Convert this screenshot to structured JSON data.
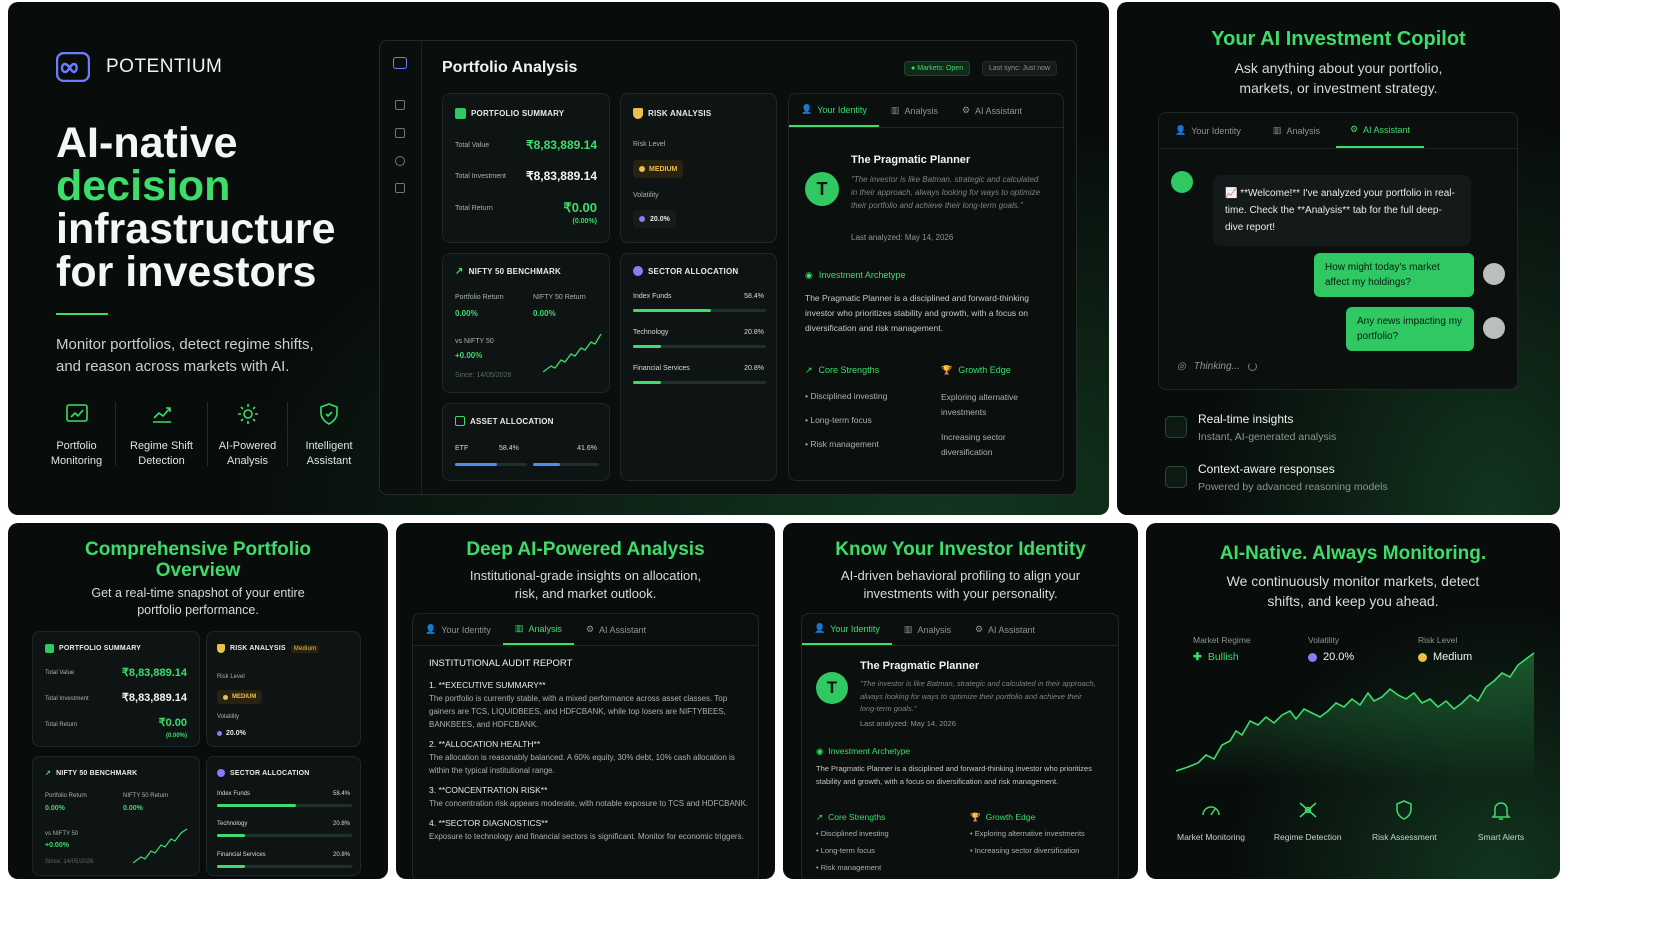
{
  "hero": {
    "brand": "POTENTIUM",
    "title_l1": "AI-native",
    "title_l2": "decision",
    "title_l3": "infrastructure",
    "title_l4": "for investors",
    "tagline_l1": "Monitor portfolios, detect regime shifts,",
    "tagline_l2": "and reason across markets with AI.",
    "features": [
      {
        "l1": "Portfolio",
        "l2": "Monitoring",
        "icon": "monitor-chart-icon"
      },
      {
        "l1": "Regime Shift",
        "l2": "Detection",
        "icon": "trend-chart-icon"
      },
      {
        "l1": "AI-Powered",
        "l2": "Analysis",
        "icon": "gear-icon"
      },
      {
        "l1": "Intelligent",
        "l2": "Assistant",
        "icon": "shield-icon"
      }
    ]
  },
  "dash": {
    "title": "Portfolio Analysis",
    "markets": "Markets: Open",
    "sync": "Last sync: Just now",
    "summary": {
      "title": "PORTFOLIO SUMMARY",
      "total_value_label": "Total Value",
      "total_value": "₹8,83,889.14",
      "total_inv_label": "Total Investment",
      "total_inv": "₹8,83,889.14",
      "total_ret_label": "Total Return",
      "total_ret": "₹0.00",
      "total_ret_pct": "(0.00%)"
    },
    "risk": {
      "title": "RISK ANALYSIS",
      "level_label": "Risk Level",
      "level": "MEDIUM",
      "vol_label": "Volatility",
      "vol": "20.0%"
    },
    "nifty": {
      "title": "NIFTY 50 BENCHMARK",
      "port_ret_label": "Portfolio Return",
      "port_ret": "0.00%",
      "nifty_ret_label": "NIFTY 50 Return",
      "nifty_ret": "0.00%",
      "vs_label": "vs NIFTY 50",
      "vs": "+0.00%",
      "since": "Since: 14/05/2026"
    },
    "sector": {
      "title": "SECTOR ALLOCATION",
      "items": [
        {
          "name": "Index Funds",
          "pct": "58.4%",
          "frac": 0.584
        },
        {
          "name": "Technology",
          "pct": "20.8%",
          "frac": 0.208
        },
        {
          "name": "Financial Services",
          "pct": "20.8%",
          "frac": 0.208
        }
      ]
    },
    "asset": {
      "title": "ASSET ALLOCATION",
      "etf": "ETF",
      "etf_pct": "58.4%",
      "other_pct": "41.6%",
      "etf_frac": 0.584,
      "other_frac": 0.416
    },
    "identity": {
      "tabs": [
        "Your Identity",
        "Analysis",
        "AI Assistant"
      ],
      "initial": "T",
      "name": "The Pragmatic Planner",
      "quote": "\"The investor is like Batman, strategic and calculated in their approach, always looking for ways to optimize their portfolio and achieve their long-term goals.\"",
      "analyzed": "Last analyzed: May 14, 2026",
      "archetype_title": "Investment Archetype",
      "archetype_text": "The Pragmatic Planner is a disciplined and forward-thinking investor who prioritizes stability and growth, with a focus on diversification and risk management.",
      "strengths_title": "Core Strengths",
      "strengths": [
        "Disciplined investing",
        "Long-term focus",
        "Risk management"
      ],
      "growth_title": "Growth Edge",
      "growth": [
        "Exploring alternative investments",
        "Increasing sector diversification"
      ]
    }
  },
  "copilot": {
    "title": "Your AI Investment Copilot",
    "sub_l1": "Ask anything about your portfolio,",
    "sub_l2": "markets, or investment strategy.",
    "tabs": [
      "Your Identity",
      "Analysis",
      "AI Assistant"
    ],
    "welcome": "📈 **Welcome!** I've analyzed your portfolio in real-time. Check the **Analysis** tab for the full deep-dive report!",
    "q1": "How might today's market affect my holdings?",
    "q2": "Any news impacting my portfolio?",
    "thinking": "Thinking...",
    "f1_title": "Real-time insights",
    "f1_sub": "Instant, AI-generated analysis",
    "f2_title": "Context-aware responses",
    "f2_sub": "Powered by advanced reasoning models"
  },
  "overview": {
    "title_l1": "Comprehensive Portfolio",
    "title_l2": "Overview",
    "sub_l1": "Get a real-time snapshot of your entire",
    "sub_l2": "portfolio performance.",
    "risk_badge": "Medium"
  },
  "deep": {
    "title": "Deep AI-Powered Analysis",
    "sub_l1": "Institutional-grade insights on allocation,",
    "sub_l2": "risk, and market outlook.",
    "report_title": "INSTITUTIONAL AUDIT REPORT",
    "sections": [
      {
        "h": "1. **EXECUTIVE SUMMARY**",
        "t": "The portfolio is currently stable, with a mixed performance across asset classes. Top gainers are TCS, LIQUIDBEES, and HDFCBANK, while top losers are NIFTYBEES, BANKBEES, and HDFCBANK."
      },
      {
        "h": "2. **ALLOCATION HEALTH**",
        "t": "The allocation is reasonably balanced. A 60% equity, 30% debt, 10% cash allocation is within the typical institutional range."
      },
      {
        "h": "3. **CONCENTRATION RISK**",
        "t": "The concentration risk appears moderate, with notable exposure to TCS and HDFCBANK."
      },
      {
        "h": "4. **SECTOR DIAGNOSTICS**",
        "t": "Exposure to technology and financial sectors is significant. Monitor for economic triggers."
      }
    ]
  },
  "know": {
    "title": "Know Your Investor Identity",
    "sub_l1": "AI-driven behavioral profiling to align your",
    "sub_l2": "investments with your personality."
  },
  "monitor": {
    "title": "AI-Native. Always Monitoring.",
    "sub_l1": "We continuously monitor markets, detect",
    "sub_l2": "shifts, and keep you ahead.",
    "regime_label": "Market Regime",
    "regime": "Bullish",
    "vol_label": "Volatility",
    "vol": "20.0%",
    "risk_label": "Risk Level",
    "risk": "Medium",
    "icons": [
      {
        "label": "Market Monitoring",
        "icon": "gauge-icon"
      },
      {
        "label": "Regime Detection",
        "icon": "network-icon"
      },
      {
        "label": "Risk Assessment",
        "icon": "shield-icon"
      },
      {
        "label": "Smart Alerts",
        "icon": "bell-icon"
      }
    ]
  },
  "colors": {
    "accent": "#3ddc6b",
    "bg": "#080c0b",
    "card": "#0e1413",
    "warn": "#e8c04a",
    "purple": "#8b7cf6"
  }
}
